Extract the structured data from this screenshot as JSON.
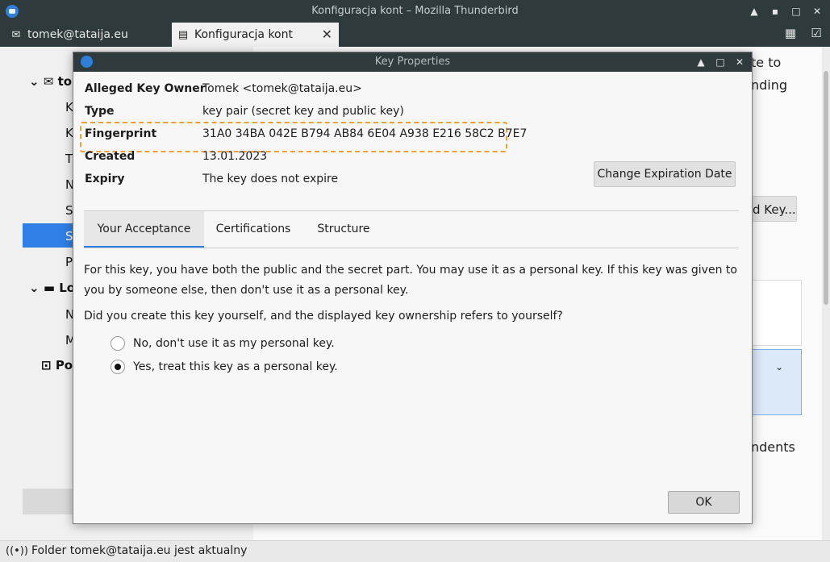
{
  "window": {
    "title": "Konfiguracja kont – Mozilla Thunderbird"
  },
  "tabs": [
    {
      "label": "tomek@tataija.eu"
    },
    {
      "label": "Konfiguracja kont"
    }
  ],
  "background": {
    "tree": {
      "account_prefix": "to",
      "item1": "K",
      "item2": "K",
      "item3": "T",
      "item4": "N",
      "item5": "S",
      "item6": "S",
      "item7": "P",
      "local_prefix": "Lo",
      "local1": "N",
      "local2": "M",
      "po": "Po"
    },
    "right_text1": "te to",
    "right_text2": "nding",
    "right_button": "d Key...",
    "right_text3": "ndents"
  },
  "dialog": {
    "title": "Key Properties",
    "properties": [
      {
        "label": "Alleged Key Owner",
        "value": "Tomek <tomek@tataija.eu>"
      },
      {
        "label": "Type",
        "value": "key pair (secret key and public key)"
      },
      {
        "label": "Fingerprint",
        "value": "31A0 34BA 042E B794 AB84 6E04 A938 E216 58C2 B7E7"
      },
      {
        "label": "Created",
        "value": "13.01.2023"
      },
      {
        "label": "Expiry",
        "value": "The key does not expire"
      }
    ],
    "change_expiration_label": "Change Expiration Date",
    "tabs": [
      "Your Acceptance",
      "Certifications",
      "Structure"
    ],
    "paragraph": "For this key, you have both the public and the secret part. You may use it as a personal key. If this key was given to you by someone else, then don't use it as a personal key.",
    "question": "Did you create this key yourself, and the displayed key ownership refers to yourself?",
    "options": [
      {
        "label": "No, don't use it as my personal key.",
        "checked": false
      },
      {
        "label": "Yes, treat this key as a personal key.",
        "checked": true
      }
    ],
    "ok_label": "OK"
  },
  "status": {
    "text": "Folder tomek@tataija.eu jest aktualny"
  },
  "colors": {
    "accent": "#2f7fe4",
    "titlebar": "#2f3a3d",
    "highlight": "#f0a030"
  }
}
